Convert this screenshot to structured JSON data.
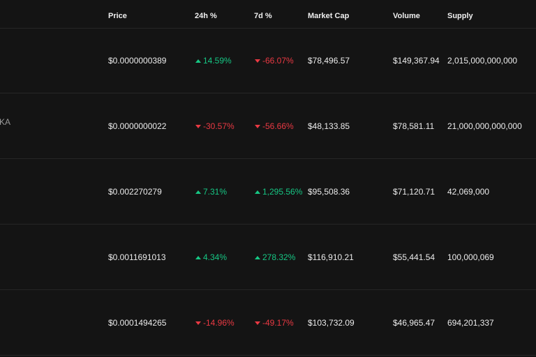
{
  "header": {
    "price": "Price",
    "change_24h": "24h %",
    "change_7d": "7d %",
    "market_cap": "Market Cap",
    "volume": "Volume",
    "supply": "Supply"
  },
  "rows": [
    {
      "name_fragment": "",
      "price": "$0.0000000389",
      "change_24h": "14.59%",
      "change_24h_dir": "up",
      "change_7d": "-66.07%",
      "change_7d_dir": "down",
      "market_cap": "$78,496.57",
      "volume": "$149,367.94",
      "supply": "2,015,000,000,000"
    },
    {
      "name_fragment": "KA",
      "price": "$0.0000000022",
      "change_24h": "-30.57%",
      "change_24h_dir": "down",
      "change_7d": "-56.66%",
      "change_7d_dir": "down",
      "market_cap": "$48,133.85",
      "volume": "$78,581.11",
      "supply": "21,000,000,000,000"
    },
    {
      "name_fragment": "",
      "price": "$0.002270279",
      "change_24h": "7.31%",
      "change_24h_dir": "up",
      "change_7d": "1,295.56%",
      "change_7d_dir": "up",
      "market_cap": "$95,508.36",
      "volume": "$71,120.71",
      "supply": "42,069,000"
    },
    {
      "name_fragment": "",
      "price": "$0.0011691013",
      "change_24h": "4.34%",
      "change_24h_dir": "up",
      "change_7d": "278.32%",
      "change_7d_dir": "up",
      "market_cap": "$116,910.21",
      "volume": "$55,441.54",
      "supply": "100,000,069"
    },
    {
      "name_fragment": "",
      "price": "$0.0001494265",
      "change_24h": "-14.96%",
      "change_24h_dir": "down",
      "change_7d": "-49.17%",
      "change_7d_dir": "down",
      "market_cap": "$103,732.09",
      "volume": "$46,965.47",
      "supply": "694,201,337"
    }
  ],
  "colors": {
    "background": "#141414",
    "up": "#16c784",
    "down": "#ea3943",
    "divider": "#262626"
  },
  "icons": {
    "up": "triangle-up-icon",
    "down": "triangle-down-icon"
  }
}
